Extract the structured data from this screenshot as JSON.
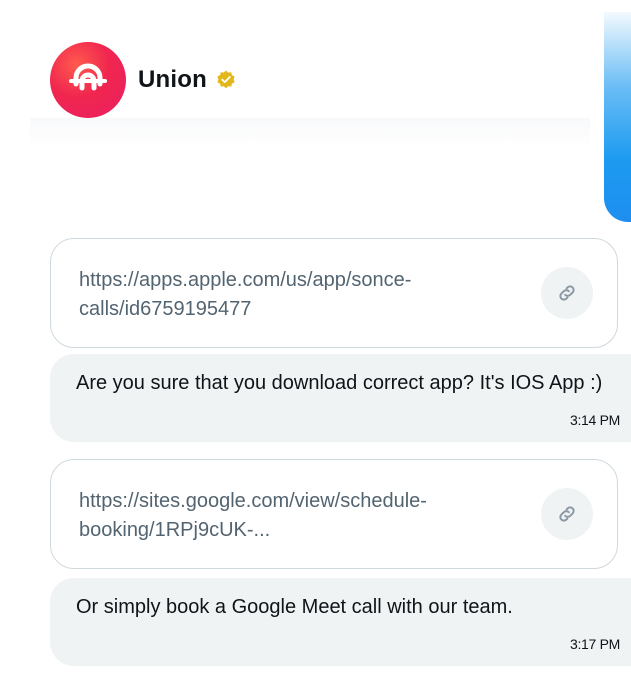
{
  "contact": {
    "name": "Union",
    "verified": true,
    "avatar_icon": "union-logo",
    "verified_icon": "verified-badge-icon",
    "accent_color": "#f0264f",
    "badge_color": "#e2b719"
  },
  "messages": [
    {
      "type": "link",
      "url": "https://apps.apple.com/us/app/sonce-calls/id6759195477",
      "icon": "link-icon"
    },
    {
      "type": "text",
      "text": "Are you sure that you download correct app? It's IOS App :)",
      "time": "3:14 PM"
    },
    {
      "type": "link",
      "url": "https://sites.google.com/view/schedule-booking/1RPj9cUK-...",
      "icon": "link-icon"
    },
    {
      "type": "text",
      "text": "Or simply book a Google Meet call with our team.",
      "time": "3:17 PM"
    }
  ],
  "colors": {
    "sent_bubble": "#1d9bf0",
    "received_bubble": "#eff3f4",
    "card_border": "#cfd9de",
    "secondary_text": "#536471"
  }
}
